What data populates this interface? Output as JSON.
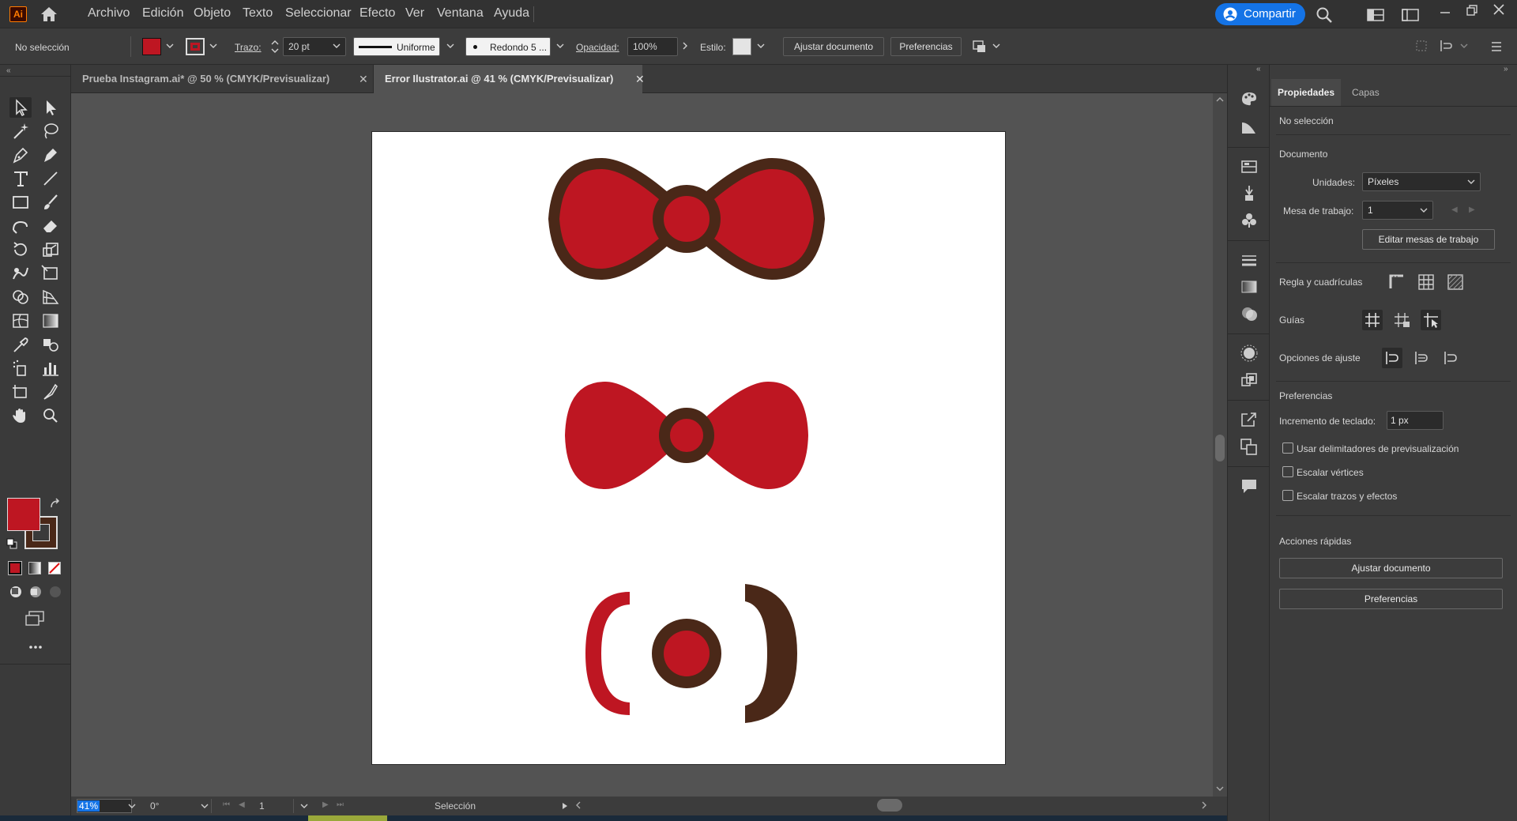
{
  "menubar": {
    "logo": "Ai",
    "items": [
      "Archivo",
      "Edición",
      "Objeto",
      "Texto",
      "Seleccionar",
      "Efecto",
      "Ver",
      "Ventana",
      "Ayuda"
    ],
    "share_label": "Compartir"
  },
  "control": {
    "selection_label": "No selección",
    "stroke_label": "Trazo:",
    "stroke_weight": "20 pt",
    "profile": "Uniforme",
    "brush": "Redondo 5 ...",
    "opacity_label": "Opacidad:",
    "opacity_value": "100%",
    "style_label": "Estilo:",
    "fit_doc_button": "Ajustar documento",
    "prefs_button": "Preferencias"
  },
  "tabs": [
    {
      "label": "Prueba Instagram.ai* @ 50 % (CMYK/Previsualizar)",
      "active": false
    },
    {
      "label": "Error Ilustrator.ai @ 41 % (CMYK/Previsualizar)",
      "active": true
    }
  ],
  "colors": {
    "fill": "#be1622",
    "stroke": "#4a2818",
    "bow_red": "#be1622",
    "bow_brown": "#4a2818",
    "accent": "#1473e6"
  },
  "status": {
    "zoom": "41%",
    "rotation": "0°",
    "artboard_number": "1",
    "tool_name": "Selección"
  },
  "properties": {
    "tab_properties": "Propiedades",
    "tab_layers": "Capas",
    "no_selection": "No selección",
    "document_heading": "Documento",
    "units_label": "Unidades:",
    "units_value": "Píxeles",
    "artboard_label": "Mesa de trabajo:",
    "artboard_value": "1",
    "edit_artboards_button": "Editar mesas de trabajo",
    "rulers_label": "Regla y cuadrículas",
    "guides_label": "Guías",
    "snap_label": "Opciones de ajuste",
    "preferences_heading": "Preferencias",
    "keyboard_increment_label": "Incremento de teclado:",
    "keyboard_increment_value": "1 px",
    "checkbox_preview_bounds": "Usar delimitadores de previsualización",
    "checkbox_scale_corners": "Escalar vértices",
    "checkbox_scale_strokes": "Escalar trazos y efectos",
    "quick_actions_heading": "Acciones rápidas",
    "quick_fit_button": "Ajustar documento",
    "quick_prefs_button": "Preferencias"
  }
}
